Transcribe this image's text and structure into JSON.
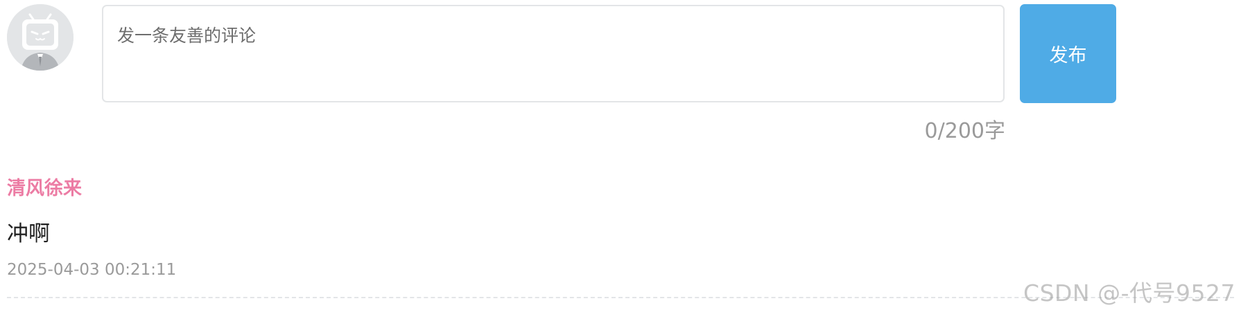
{
  "composer": {
    "avatar_icon": "bilibili-tv-mascot-icon",
    "placeholder": "发一条友善的评论",
    "value": "",
    "publish_label": "发布",
    "char_count": "0/200字"
  },
  "comments": [
    {
      "author": "清风徐来",
      "content": "冲啊",
      "time": "2025-04-03 00:21:11"
    }
  ],
  "watermark": "CSDN @-代号9527",
  "colors": {
    "accent": "#4fabe6",
    "author": "#ec7ca4",
    "border": "#e3e5e7",
    "muted_text": "#9a9a9a"
  }
}
